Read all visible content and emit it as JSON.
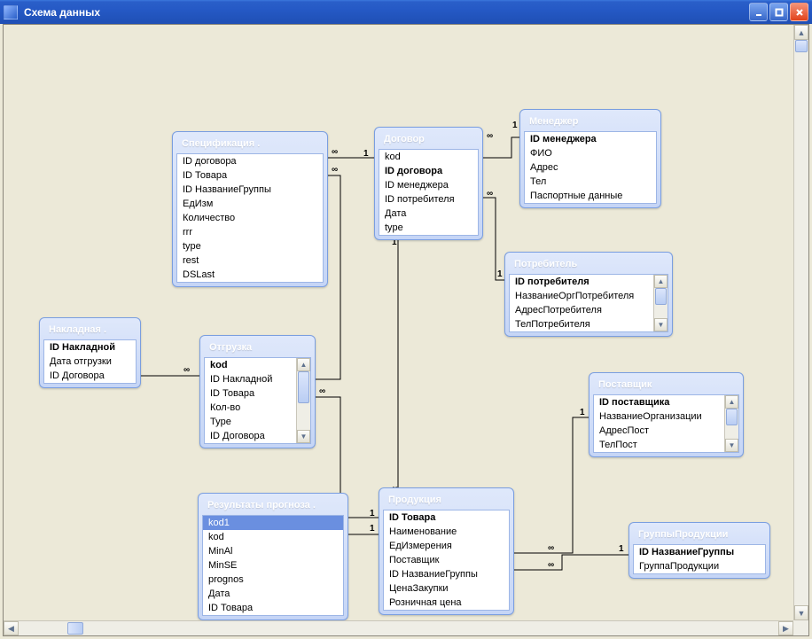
{
  "window": {
    "title": "Схема данных"
  },
  "labels": {
    "one": "1",
    "many": "∞"
  },
  "tables": {
    "spec": {
      "title": "Спецификация .",
      "fields": [
        "ID договора",
        "ID Товара",
        "ID НазваниеГруппы",
        "ЕдИзм",
        "Количество",
        "rrr",
        "type",
        "rest",
        "DSLast"
      ]
    },
    "dogovor": {
      "title": "Договор",
      "fields": [
        "kod",
        "ID договора",
        "ID менеджера",
        "ID потребителя",
        "Дата",
        "type"
      ]
    },
    "manager": {
      "title": "Менеджер",
      "fields": [
        "ID менеджера",
        "ФИО",
        "Адрес",
        "Тел",
        "Паспортные данные"
      ]
    },
    "potreb": {
      "title": "Потребитель",
      "fields": [
        "ID потребителя",
        "НазваниеОргПотребителя",
        "АдресПотребителя",
        "ТелПотребителя"
      ]
    },
    "nakladnaya": {
      "title": "Накладная .",
      "fields": [
        "ID Накладной",
        "Дата отгрузки",
        "ID Договора"
      ]
    },
    "otgruzka": {
      "title": "Отгрузка",
      "fields": [
        "kod",
        "ID Накладной",
        "ID Товара",
        "Кол-во",
        "Type",
        "ID Договора"
      ]
    },
    "postav": {
      "title": "Поставщик",
      "fields": [
        "ID поставщика",
        "НазваниеОрганизации",
        "АдресПост",
        "ТелПост"
      ]
    },
    "results": {
      "title": "Результаты прогноза .",
      "fields": [
        "kod1",
        "kod",
        "MinAl",
        "MinSE",
        "prognos",
        "Дата",
        "ID Товара"
      ]
    },
    "product": {
      "title": "Продукция",
      "fields": [
        "ID Товара",
        "Наименование",
        "ЕдИзмерения",
        "Поставщик",
        "ID НазваниеГруппы",
        "ЦенаЗакупки",
        "Розничная цена"
      ]
    },
    "group": {
      "title": "ГруппыПродукции",
      "fields": [
        "ID НазваниеГруппы",
        "ГруппаПродукции"
      ]
    }
  }
}
